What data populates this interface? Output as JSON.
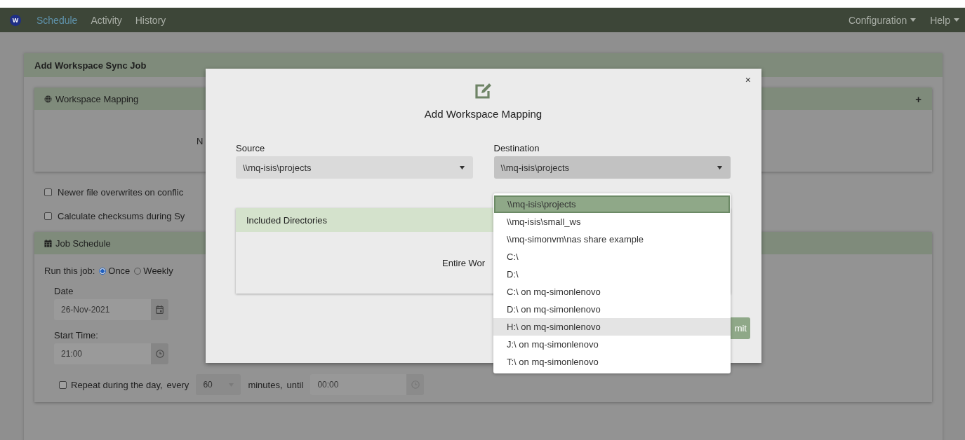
{
  "navbar": {
    "logo": "W",
    "tabs": [
      {
        "label": "Schedule",
        "selected": true
      },
      {
        "label": "Activity",
        "selected": false
      },
      {
        "label": "History",
        "selected": false
      }
    ],
    "menus": [
      "Configuration",
      "Help"
    ]
  },
  "job_card": {
    "title": "Add Workspace Sync Job",
    "mapping_panel": {
      "title": "Workspace Mapping",
      "add": "+",
      "empty_text": "N"
    },
    "options": [
      {
        "label": "Newer file overwrites on conflic",
        "checked": false
      },
      {
        "label": "Calculate checksums during Sy",
        "checked": false
      }
    ],
    "schedule_panel": {
      "title": "Job Schedule",
      "run_label": "Run this job:",
      "frequency": [
        {
          "label": "Once",
          "selected": true
        },
        {
          "label": "Weekly",
          "selected": false
        }
      ],
      "date": {
        "label": "Date",
        "value": "26-Nov-2021"
      },
      "start_time": {
        "label": "Start Time:",
        "value": "21:00"
      },
      "repeat": {
        "checked": false,
        "label": "Repeat during the day,",
        "every": "every",
        "interval": "60",
        "unit": "minutes,",
        "until": "until",
        "until_value": "00:00"
      }
    }
  },
  "modal": {
    "title": "Add Workspace Mapping",
    "close": "×",
    "source": {
      "label": "Source",
      "value": "\\\\mq-isis\\projects"
    },
    "destination": {
      "label": "Destination",
      "value": "\\\\mq-isis\\projects",
      "expanded": true,
      "options": [
        {
          "label": "\\\\mq-isis\\projects",
          "selected": true,
          "hovered": false
        },
        {
          "label": "\\\\mq-isis\\small_ws",
          "selected": false,
          "hovered": false
        },
        {
          "label": "\\\\mq-simonvm\\nas share example",
          "selected": false,
          "hovered": false
        },
        {
          "label": "C:\\",
          "selected": false,
          "hovered": false
        },
        {
          "label": "D:\\",
          "selected": false,
          "hovered": false
        },
        {
          "label": "C:\\ on mq-simonlenovo",
          "selected": false,
          "hovered": false
        },
        {
          "label": "D:\\ on mq-simonlenovo",
          "selected": false,
          "hovered": false
        },
        {
          "label": "H:\\ on mq-simonlenovo",
          "selected": false,
          "hovered": true
        },
        {
          "label": "J:\\ on mq-simonlenovo",
          "selected": false,
          "hovered": false
        },
        {
          "label": "T:\\ on mq-simonlenovo",
          "selected": false,
          "hovered": false
        }
      ]
    },
    "included": {
      "title": "Included Directories",
      "body": "Entire Wor"
    },
    "submit": "mit"
  }
}
